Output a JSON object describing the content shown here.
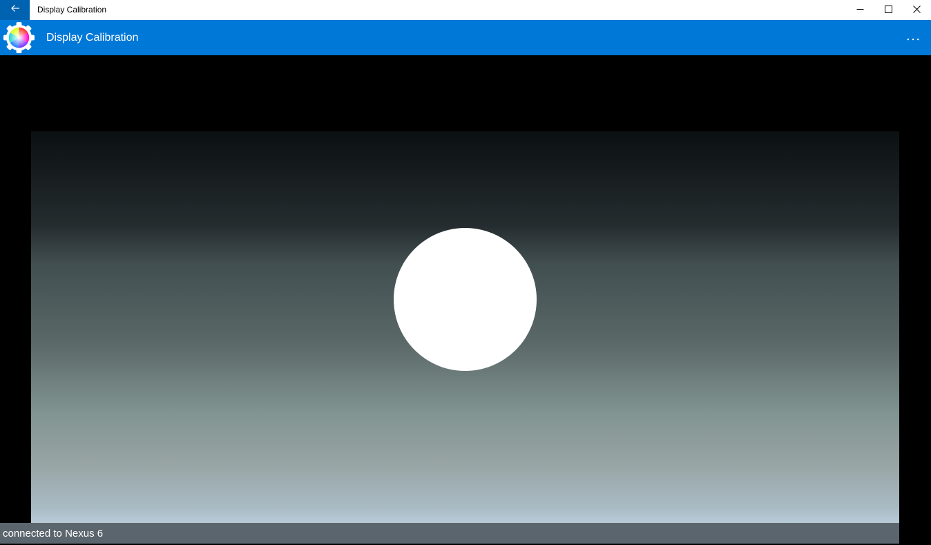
{
  "window": {
    "title": "Display Calibration",
    "back_icon": "arrow-left-icon",
    "controls": [
      "minimize-icon",
      "maximize-icon",
      "close-icon"
    ]
  },
  "appbar": {
    "title": "Display Calibration",
    "logo_icon": "color-wheel-gear-icon",
    "more_label": "···",
    "accent": "#0078d7"
  },
  "content": {
    "background": "#000000",
    "gradient_top": "#0b1011",
    "gradient_bottom": "#b7cbd7",
    "circle_color": "#ffffff"
  },
  "status": {
    "text": "connected to Nexus 6"
  }
}
